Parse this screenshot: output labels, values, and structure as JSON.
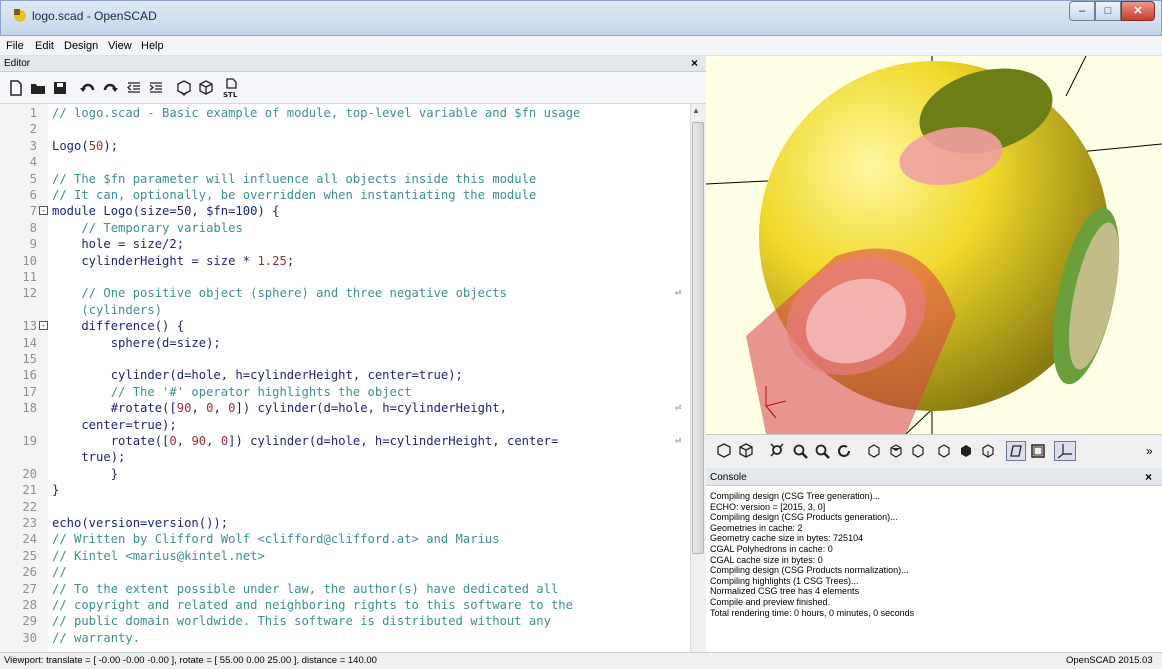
{
  "window": {
    "title": "logo.scad - OpenSCAD",
    "min": "–",
    "max": "□",
    "close": "✕"
  },
  "menu": [
    "File",
    "Edit",
    "Design",
    "View",
    "Help"
  ],
  "editor": {
    "title": "Editor",
    "close": "×",
    "toolbar_icons": [
      "new-file-icon",
      "open-file-icon",
      "save-file-icon",
      "undo-icon",
      "redo-icon",
      "unindent-icon",
      "indent-icon",
      "preview-icon",
      "render-icon",
      "export-stl-icon"
    ],
    "lines": [
      {
        "n": "1",
        "parts": [
          [
            "c",
            "// logo.scad - Basic example of module, top-level variable and $fn usage"
          ]
        ]
      },
      {
        "n": "2",
        "parts": []
      },
      {
        "n": "3",
        "parts": [
          [
            "k",
            "Logo("
          ],
          [
            "n",
            "50"
          ],
          [
            "k",
            ");"
          ]
        ]
      },
      {
        "n": "4",
        "parts": []
      },
      {
        "n": "5",
        "parts": [
          [
            "c",
            "// The $fn parameter will influence all objects inside this module"
          ]
        ]
      },
      {
        "n": "6",
        "parts": [
          [
            "c",
            "// It can, optionally, be overridden when instantiating the module"
          ]
        ]
      },
      {
        "n": "7",
        "fold": "-",
        "parts": [
          [
            "k",
            "module Logo(size=50, $fn=100) {"
          ]
        ]
      },
      {
        "n": "8",
        "parts": [
          [
            "k",
            "    "
          ],
          [
            "c",
            "// Temporary variables"
          ]
        ]
      },
      {
        "n": "9",
        "parts": [
          [
            "k",
            "    hole = size/2;"
          ]
        ]
      },
      {
        "n": "10",
        "parts": [
          [
            "k",
            "    cylinderHeight = size * "
          ],
          [
            "n",
            "1.25"
          ],
          [
            "k",
            ";"
          ]
        ]
      },
      {
        "n": "11",
        "parts": []
      },
      {
        "n": "12",
        "wrap": "⏎",
        "parts": [
          [
            "k",
            "    "
          ],
          [
            "c",
            "// One positive object (sphere) and three negative objects"
          ]
        ]
      },
      {
        "n": "",
        "parts": [
          [
            "k",
            "    "
          ],
          [
            "c",
            "(cylinders)"
          ]
        ]
      },
      {
        "n": "13",
        "fold": "-",
        "parts": [
          [
            "k",
            "    difference() {"
          ]
        ]
      },
      {
        "n": "14",
        "parts": [
          [
            "k",
            "        sphere(d=size);"
          ]
        ]
      },
      {
        "n": "15",
        "parts": []
      },
      {
        "n": "16",
        "parts": [
          [
            "k",
            "        cylinder(d=hole, h=cylinderHeight, center=true);"
          ]
        ]
      },
      {
        "n": "17",
        "parts": [
          [
            "k",
            "        "
          ],
          [
            "c",
            "// The '#' operator highlights the object"
          ]
        ]
      },
      {
        "n": "18",
        "wrap": "⏎",
        "parts": [
          [
            "k",
            "        #rotate(["
          ],
          [
            "n",
            "90"
          ],
          [
            "k",
            ", "
          ],
          [
            "n",
            "0"
          ],
          [
            "k",
            ", "
          ],
          [
            "n",
            "0"
          ],
          [
            "k",
            "]) cylinder(d=hole, h=cylinderHeight,"
          ]
        ]
      },
      {
        "n": "",
        "parts": [
          [
            "k",
            "    center=true);"
          ]
        ]
      },
      {
        "n": "19",
        "wrap": "⏎",
        "parts": [
          [
            "k",
            "        rotate(["
          ],
          [
            "n",
            "0"
          ],
          [
            "k",
            ", "
          ],
          [
            "n",
            "90"
          ],
          [
            "k",
            ", "
          ],
          [
            "n",
            "0"
          ],
          [
            "k",
            "]) cylinder(d=hole, h=cylinderHeight, center="
          ]
        ]
      },
      {
        "n": "",
        "parts": [
          [
            "k",
            "    true);"
          ]
        ]
      },
      {
        "n": "20",
        "parts": [
          [
            "k",
            "        }"
          ]
        ]
      },
      {
        "n": "21",
        "parts": [
          [
            "k",
            "}"
          ]
        ]
      },
      {
        "n": "22",
        "parts": []
      },
      {
        "n": "23",
        "parts": [
          [
            "k",
            "echo(version=version());"
          ]
        ]
      },
      {
        "n": "24",
        "parts": [
          [
            "c",
            "// Written by Clifford Wolf <clifford@clifford.at> and Marius"
          ]
        ]
      },
      {
        "n": "25",
        "parts": [
          [
            "c",
            "// Kintel <marius@kintel.net>"
          ]
        ]
      },
      {
        "n": "26",
        "parts": [
          [
            "c",
            "//"
          ]
        ]
      },
      {
        "n": "27",
        "parts": [
          [
            "c",
            "// To the extent possible under law, the author(s) have dedicated all"
          ]
        ]
      },
      {
        "n": "28",
        "parts": [
          [
            "c",
            "// copyright and related and neighboring rights to this software to the"
          ]
        ]
      },
      {
        "n": "29",
        "parts": [
          [
            "c",
            "// public domain worldwide. This software is distributed without any"
          ]
        ]
      },
      {
        "n": "30",
        "parts": [
          [
            "c",
            "// warranty."
          ]
        ]
      }
    ]
  },
  "view_toolbar_icons": [
    "preview-icon",
    "render-icon",
    "view-all-icon",
    "zoom-in-icon",
    "zoom-out-icon",
    "reset-view-icon",
    "view-right-icon",
    "view-top-icon",
    "view-bottom-icon",
    "view-left-icon",
    "view-front-icon",
    "view-back-icon",
    "perspective-icon",
    "orthogonal-icon",
    "show-axes-icon",
    "more-icon"
  ],
  "console": {
    "title": "Console",
    "close": "×",
    "lines": [
      "Compiling design (CSG Tree generation)...",
      "ECHO: version = [2015, 3, 0]",
      "Compiling design (CSG Products generation)...",
      "Geometries in cache: 2",
      "Geometry cache size in bytes: 725104",
      "CGAL Polyhedrons in cache: 0",
      "CGAL cache size in bytes: 0",
      "Compiling design (CSG Products normalization)...",
      "Compiling highlights (1 CSG Trees)...",
      "Normalized CSG tree has 4 elements",
      "Compile and preview finished.",
      "Total rendering time: 0 hours, 0 minutes, 0 seconds"
    ]
  },
  "status": {
    "viewport": "Viewport: translate = [ -0.00 -0.00 -0.00 ], rotate = [ 55.00 0.00 25.00 ], distance = 140.00",
    "version": "OpenSCAD 2015.03"
  }
}
